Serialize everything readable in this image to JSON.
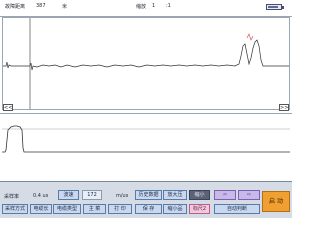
{
  "top": {
    "fault_distance_label": "故障距离",
    "fault_distance_value": "387",
    "fault_distance_unit": "米",
    "scale_label": "缩放",
    "scale_value": "1",
    "scale_sep": ":1"
  },
  "battery_level": 0.85,
  "nav": {
    "left": "<<",
    "right": ">>"
  },
  "panel": {
    "sample_rate_label": "采样率",
    "sample_rate_value": "0.4 us",
    "speed_label": "波速",
    "speed_value": "172",
    "speed_unit": "m/us",
    "history_button": "历史数据",
    "zoom_in_button": "放大压",
    "reduce_button": "缩小",
    "sample_mode_button": "采样方式",
    "cable_length_button": "电缆长",
    "cable_type_button": "电缆类型",
    "main_menu_button": "主 菜",
    "print_button": "打 印",
    "save_button": "保 存",
    "shrink_button": "缩小品",
    "marker2_button": "标尺2",
    "auto_judge_button": "自动判断",
    "start_button": "启 动",
    "arrow_left": "⇦",
    "arrow_right": "⇨"
  }
}
